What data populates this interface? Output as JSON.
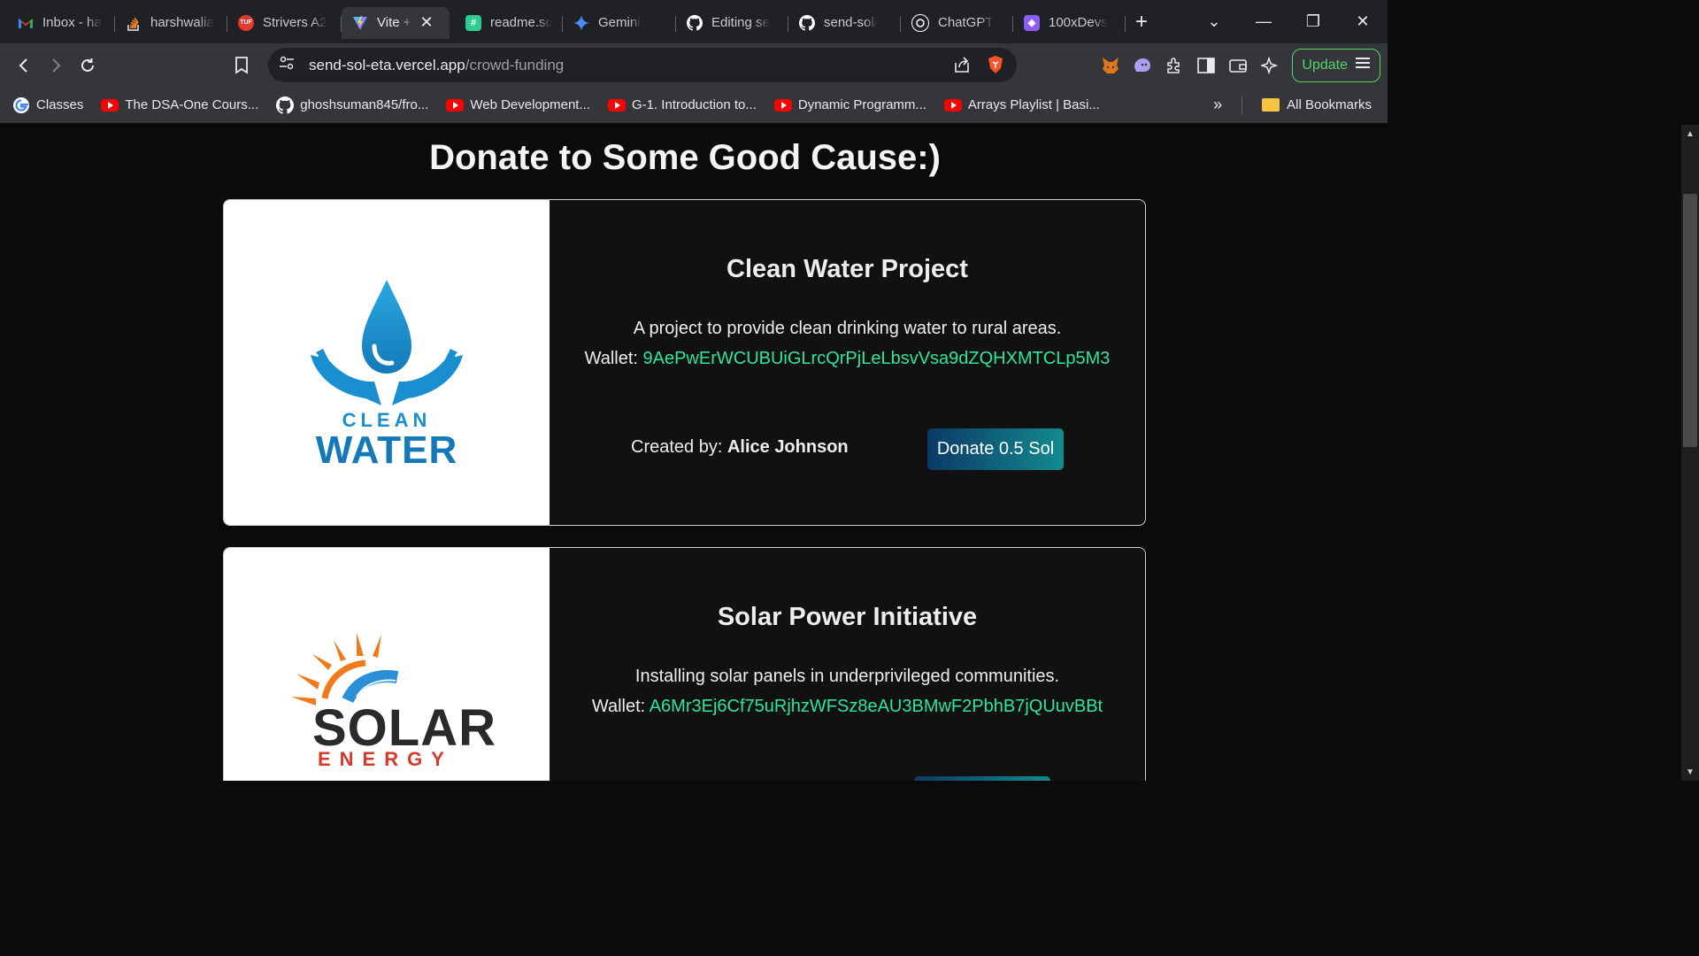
{
  "browser": {
    "tabs": [
      {
        "title": "Inbox - ha",
        "favicon": "gmail-icon",
        "color": "#ea4335",
        "active": false
      },
      {
        "title": "harshwalia",
        "favicon": "stackoverflow-icon",
        "color": "#f48024",
        "active": false
      },
      {
        "title": "Strivers A2",
        "favicon": "tuf-icon",
        "color": "#e5392d",
        "active": false
      },
      {
        "title": "Vite +",
        "favicon": "vite-icon",
        "color": "#a66bff",
        "active": true
      },
      {
        "title": "readme.so",
        "favicon": "readme-icon",
        "color": "#2ecc8f",
        "active": false
      },
      {
        "title": "Gemini",
        "favicon": "gemini-icon",
        "color": "#4a8cff",
        "active": false
      },
      {
        "title": "Editing se",
        "favicon": "github-icon",
        "color": "#ffffff",
        "active": false
      },
      {
        "title": "send-sol/",
        "favicon": "github-icon",
        "color": "#ffffff",
        "active": false
      },
      {
        "title": "ChatGPT",
        "favicon": "chatgpt-icon",
        "color": "#ffffff",
        "active": false
      },
      {
        "title": "100xDevs",
        "favicon": "100xdevs-icon",
        "color": "#8b5cf6",
        "active": false
      }
    ],
    "url_host": "send-sol-eta.vercel.app",
    "url_path": "/crowd-funding",
    "update_label": "Update",
    "bookmarks": [
      {
        "label": "Classes",
        "icon": "google-icon"
      },
      {
        "label": "The DSA-One Cours...",
        "icon": "youtube-icon"
      },
      {
        "label": "ghoshsuman845/fro...",
        "icon": "github-icon"
      },
      {
        "label": "Web Development...",
        "icon": "youtube-icon"
      },
      {
        "label": "G-1. Introduction to...",
        "icon": "youtube-icon"
      },
      {
        "label": "Dynamic Programm...",
        "icon": "youtube-icon"
      },
      {
        "label": "Arrays Playlist | Basi...",
        "icon": "youtube-icon"
      }
    ],
    "all_bookmarks_label": "All Bookmarks"
  },
  "page": {
    "heading": "Donate to Some Good Cause:)",
    "wallet_prefix": "Wallet: ",
    "created_prefix": "Created by: ",
    "projects": [
      {
        "title": "Clean Water Project",
        "description": "A project to provide clean drinking water to rural areas.",
        "wallet": "9AePwErWCUBUiGLrcQrPjLeLbsvVsa9dZQHXMTCLp5M3",
        "creator": "Alice Johnson",
        "donate_label": "Donate 0.5 Sol",
        "logo_line1": "CLEAN",
        "logo_line2": "WATER"
      },
      {
        "title": "Solar Power Initiative",
        "description": "Installing solar panels in underprivileged communities.",
        "wallet": "A6Mr3Ej6Cf75uRjhzWFSz8eAU3BMwF2PbhB7jQUuvBBt",
        "creator": "",
        "donate_label": "",
        "logo_line1": "SOLAR",
        "logo_line2": "ENERGY"
      }
    ]
  },
  "colors": {
    "accent_green": "#2ee59d",
    "update_green": "#57d36b",
    "page_bg": "#0b0b0b"
  }
}
